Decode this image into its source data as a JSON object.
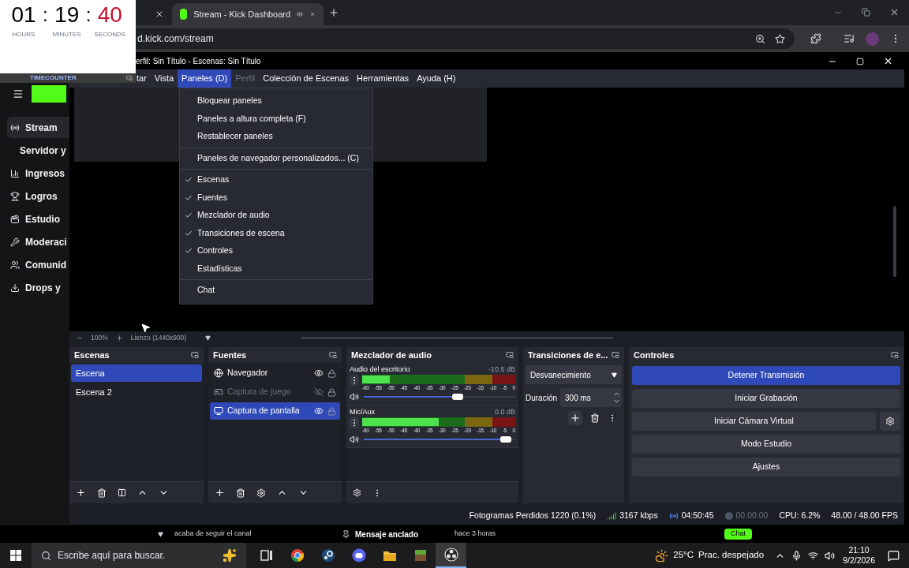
{
  "timer": {
    "hours": "01",
    "minutes": "19",
    "seconds": "40",
    "separators": [
      ":",
      ":"
    ],
    "labels": [
      "HOURS",
      "MINUTES",
      "SECONDS"
    ],
    "brand": "TIMECOUNTER"
  },
  "browser": {
    "tabs": [
      {
        "selected": false,
        "audio": false
      },
      {
        "title": "Stream - Kick Dashboard",
        "selected": true,
        "audio": true
      }
    ],
    "address": "d.kick.com/stream"
  },
  "kick": {
    "nav": [
      {
        "label": "Stream",
        "kind": "live",
        "selected": true,
        "children": [
          {
            "label": "Servidor y",
            "selected": false
          }
        ]
      },
      {
        "label": "Ingresos",
        "kind": "chart",
        "selected": false
      },
      {
        "label": "Logros",
        "kind": "trophy",
        "selected": false
      },
      {
        "label": "Estudio",
        "kind": "studio",
        "selected": false
      },
      {
        "label": "Moderaci",
        "kind": "wrench",
        "selected": false
      },
      {
        "label": "Comunid",
        "kind": "users",
        "selected": false
      },
      {
        "label": "Drops y",
        "kind": "download",
        "selected": false
      }
    ],
    "footer": {
      "follow": "acaba de seguir el canal",
      "pinned": "Mensaje anclado",
      "time": "hace 3 horas",
      "chat": "Chat"
    }
  },
  "obs": {
    "title": "erfil: Sin Título - Escenas: Sin Título",
    "menu": [
      {
        "label": "tar",
        "selected": false,
        "disabled": false
      },
      {
        "label": "Vista",
        "selected": false,
        "disabled": false
      },
      {
        "label": "Paneles (D)",
        "selected": true,
        "disabled": false
      },
      {
        "label": "Perfil",
        "selected": false,
        "disabled": true
      },
      {
        "label": "Colección de Escenas",
        "selected": false,
        "disabled": false
      },
      {
        "label": "Herramientas",
        "selected": false,
        "disabled": false
      },
      {
        "label": "Ayuda (H)",
        "selected": false,
        "disabled": false
      }
    ],
    "panels_menu": [
      [
        {
          "label": "Bloquear paneles",
          "checked": false
        },
        {
          "label": "Paneles a altura completa (F)",
          "checked": false
        },
        {
          "label": "Restablecer paneles",
          "checked": false
        }
      ],
      [
        {
          "label": "Paneles de navegador personalizados... (C)",
          "checked": false
        }
      ],
      [
        {
          "label": "Escenas",
          "checked": true
        },
        {
          "label": "Fuentes",
          "checked": true
        },
        {
          "label": "Mezclador de audio",
          "checked": true
        },
        {
          "label": "Transiciones de escena",
          "checked": true
        },
        {
          "label": "Controles",
          "checked": true
        },
        {
          "label": "Estadísticas",
          "checked": false
        }
      ],
      [
        {
          "label": "Chat",
          "checked": false
        }
      ]
    ],
    "zoom": "100%",
    "canvas": "Lienzo (1440x900)",
    "scenes": {
      "title": "Escenas",
      "items": [
        {
          "name": "Escena",
          "selected": true
        },
        {
          "name": "Escena 2",
          "selected": false
        }
      ]
    },
    "sources": {
      "title": "Fuentes",
      "items": [
        {
          "name": "Navegador",
          "kind": "browser",
          "visible": true,
          "selected": false
        },
        {
          "name": "Captura de juego",
          "kind": "game",
          "visible": false,
          "selected": false
        },
        {
          "name": "Captura de pantalla",
          "kind": "display",
          "visible": true,
          "selected": true
        }
      ]
    },
    "mixer": {
      "title": "Mezclador de audio",
      "channels": [
        {
          "name": "Audio del escritorio",
          "reading": "-10.5 dB",
          "meter": {
            "level": 0.18
          },
          "fader": {
            "level": 0.63
          },
          "ticks": [
            "-60",
            "-55",
            "-50",
            "-45",
            "-40",
            "-35",
            "-30",
            "-25",
            "-20",
            "-15",
            "-10",
            "-5",
            "0"
          ]
        },
        {
          "name": "Mic/Aux",
          "reading": "0.0 dB",
          "meter": {
            "level": 0.5
          },
          "fader": {
            "level": 0.97
          },
          "ticks": [
            "-60",
            "-55",
            "-50",
            "-45",
            "-40",
            "-35",
            "-30",
            "-25",
            "-20",
            "-15",
            "-10",
            "-5",
            "0"
          ]
        }
      ]
    },
    "transitions": {
      "title": "Transiciones de e...",
      "type": "Desvanecimiento",
      "duration_label": "Duración",
      "duration": "300 ms"
    },
    "controls": {
      "title": "Controles",
      "buttons": [
        {
          "label": "Detener Transmisión",
          "active": true,
          "kind": "plain"
        },
        {
          "label": "Iniciar Grabación",
          "active": false,
          "kind": "plain"
        },
        {
          "label": "Iniciar Cámara Virtual",
          "active": false,
          "kind": "settings"
        },
        {
          "label": "Modo Estudio",
          "active": false,
          "kind": "plain"
        },
        {
          "label": "Ajustes",
          "active": false,
          "kind": "plain"
        }
      ]
    },
    "status": {
      "dropped": "Fotogramas Perdidos 1220 (0.1%)",
      "bitrate": "3167 kbps",
      "live": "04:50:45",
      "recording": "00:00:00",
      "cpu": "CPU: 6.2%",
      "fps": "48.00 / 48.00 FPS"
    }
  },
  "taskbar": {
    "search": {
      "placeholder": "Escribe aquí para buscar."
    },
    "apps": [
      {
        "kind": "taskview",
        "selected": false
      },
      {
        "kind": "chrome",
        "selected": false
      },
      {
        "kind": "steam",
        "selected": false
      },
      {
        "kind": "discord",
        "selected": false
      },
      {
        "kind": "folder",
        "selected": false
      },
      {
        "kind": "minecraft",
        "selected": false
      },
      {
        "kind": "obs",
        "selected": true
      }
    ],
    "temperature": "25°C",
    "weather": "Prac. despejado",
    "time": "21:10",
    "date": "9/2/2026"
  }
}
